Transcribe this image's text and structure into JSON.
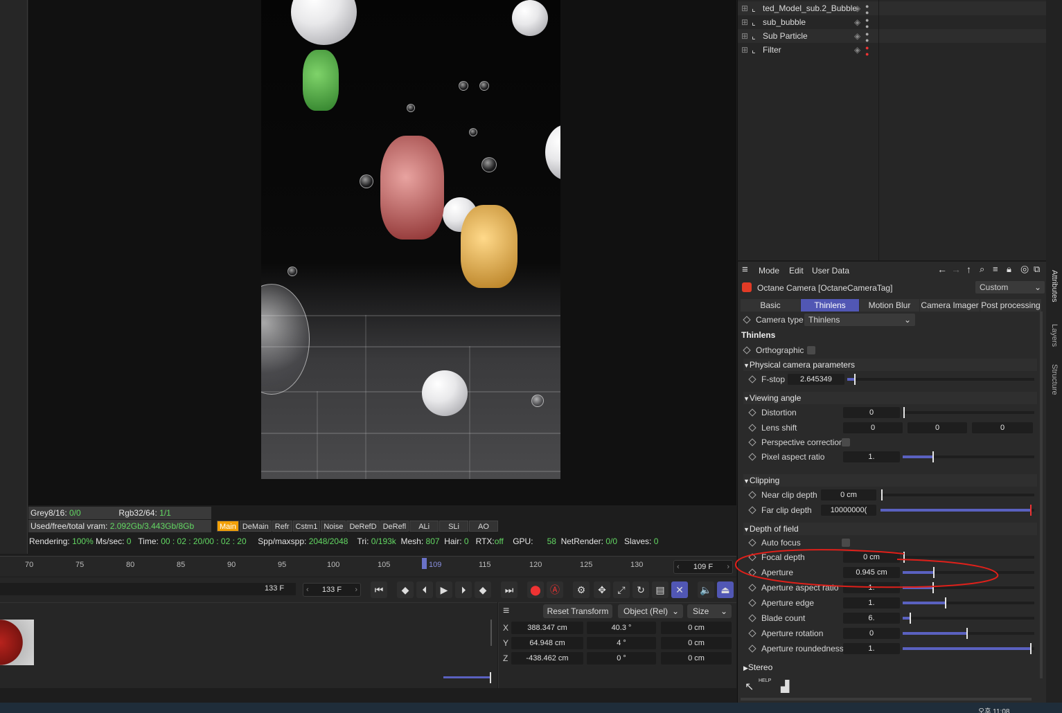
{
  "objects": [
    {
      "name": "ted_Model_sub.2_Bubble"
    },
    {
      "name": "sub_bubble"
    },
    {
      "name": "Sub Particle"
    },
    {
      "name": "Filter"
    }
  ],
  "attr_menu": {
    "mode": "Mode",
    "edit": "Edit",
    "user_data": "User Data"
  },
  "attr_title": "Octane Camera [OctaneCameraTag]",
  "attr_preset": "Custom",
  "tabs": [
    "Basic",
    "Thinlens",
    "Motion Blur",
    "Camera Imager",
    "Post processing"
  ],
  "camera_type": {
    "label": "Camera type",
    "value": "Thinlens"
  },
  "section_title": "Thinlens",
  "orthographic": "Orthographic",
  "groups": {
    "physical": "Physical camera parameters",
    "viewing": "Viewing angle",
    "clipping": "Clipping",
    "dof": "Depth of field",
    "stereo": "Stereo"
  },
  "params": {
    "fstop": {
      "label": "F-stop",
      "value": "2.645349"
    },
    "distortion": {
      "label": "Distortion",
      "value": "0"
    },
    "lensshift": {
      "label": "Lens shift",
      "v1": "0",
      "v2": "0",
      "v3": "0"
    },
    "perspective": {
      "label": "Perspective correction"
    },
    "pixelaspect": {
      "label": "Pixel aspect ratio",
      "value": "1."
    },
    "nearclip": {
      "label": "Near clip depth",
      "value": "0 cm"
    },
    "farclip": {
      "label": "Far clip depth",
      "value": "10000000("
    },
    "autofocus": {
      "label": "Auto focus"
    },
    "focaldepth": {
      "label": "Focal depth",
      "value": "0 cm"
    },
    "aperture": {
      "label": "Aperture",
      "value": "0.945 cm"
    },
    "apaspect": {
      "label": "Aperture aspect ratio",
      "value": "1."
    },
    "apedge": {
      "label": "Aperture edge",
      "value": "1."
    },
    "blades": {
      "label": "Blade count",
      "value": "6."
    },
    "aprot": {
      "label": "Aperture rotation",
      "value": "0"
    },
    "aproundness": {
      "label": "Aperture roundedness",
      "value": "1."
    }
  },
  "side_tabs": [
    "Attributes",
    "Layers",
    "Structure"
  ],
  "stats": {
    "grey_label": "Grey8/16:",
    "grey_val": "0/0",
    "rgb_label": "Rgb32/64:",
    "rgb_val": "1/1",
    "vram_label": "Used/free/total vram:",
    "vram_val": "2.092Gb/3.443Gb/8Gb",
    "chips": [
      "Main",
      "DeMain",
      "Refr",
      "Cstm1",
      "Noise",
      "DeRefD",
      "DeRefl",
      "ALi",
      "SLi",
      "AO"
    ],
    "rendering_label": "Rendering:",
    "rendering_val": "100%",
    "mssec_label": "Ms/sec:",
    "mssec_val": "0",
    "time_label": "Time:",
    "time_val": "00 : 02 : 20/00 : 02 : 20",
    "spp_label": "Spp/maxspp:",
    "spp_val": "2048/2048",
    "tri_label": "Tri:",
    "tri_val": "0/193k",
    "mesh_label": "Mesh:",
    "mesh_val": "807",
    "hair_label": "Hair:",
    "hair_val": "0",
    "rtx_label": "RTX:",
    "rtx_val": "off",
    "gpu_label": "GPU:",
    "gpu_val": "58",
    "netrender_label": "NetRender:",
    "netrender_val": "0/0",
    "slaves_label": "Slaves:",
    "slaves_val": "0"
  },
  "timeline": {
    "ticks": [
      "70",
      "75",
      "80",
      "85",
      "90",
      "95",
      "100",
      "105",
      "109",
      "115",
      "120",
      "125",
      "130"
    ],
    "current_frame": "109 F"
  },
  "transport": {
    "end_frame": "133 F",
    "end_frame2": "133 F"
  },
  "coords": {
    "reset": "Reset Transform",
    "mode": "Object (Rel)",
    "size": "Size",
    "x_label": "X",
    "y_label": "Y",
    "z_label": "Z",
    "px": "388.347 cm",
    "py": "64.948 cm",
    "pz": "-438.462 cm",
    "rx": "40.3 °",
    "ry": "4 °",
    "rz": "0 °",
    "sx": "0 cm",
    "sy": "0 cm",
    "sz": "0 cm"
  },
  "taskbar_time": "오후 11:08",
  "help_label": "HELP",
  "colors": {
    "accent": "#5157b4",
    "orange": "#f2a007",
    "green": "#63d863",
    "annotation": "#e0201a"
  }
}
